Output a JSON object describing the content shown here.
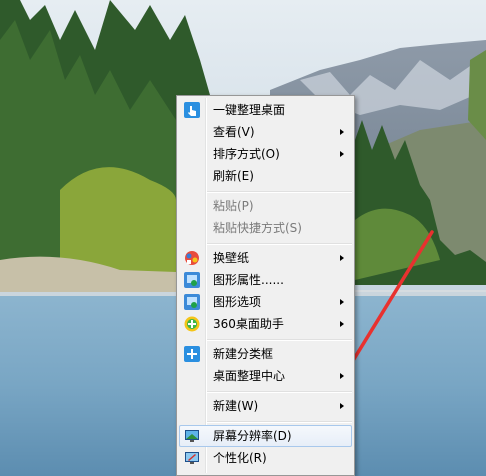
{
  "menu": {
    "items": [
      {
        "label": "一键整理桌面",
        "icon": "touch-icon"
      },
      {
        "label": "查看(V)"
      },
      {
        "label": "排序方式(O)"
      },
      {
        "label": "刷新(E)"
      },
      {
        "label": "粘贴(P)",
        "disabled": true
      },
      {
        "label": "粘贴快捷方式(S)",
        "disabled": true
      },
      {
        "label": "换壁纸",
        "icon": "wallpaper-icon"
      },
      {
        "label": "图形属性......",
        "icon": "graphics-properties-icon"
      },
      {
        "label": "图形选项",
        "icon": "graphics-options-icon"
      },
      {
        "label": "360桌面助手",
        "icon": "360-icon"
      },
      {
        "label": "新建分类框",
        "icon": "add-box-icon"
      },
      {
        "label": "桌面整理中心"
      },
      {
        "label": "新建(W)"
      },
      {
        "label": "屏幕分辨率(D)",
        "icon": "screen-resolution-icon",
        "highlighted": true
      },
      {
        "label": "个性化(R)",
        "icon": "personalize-icon"
      }
    ]
  },
  "colors": {
    "menu_bg": "#f0f0f0",
    "hover_border": "#a8c8ec",
    "annotation_arrow": "#e8312f",
    "sky": "#c9d6e2",
    "lake": "#6f9fc0"
  }
}
